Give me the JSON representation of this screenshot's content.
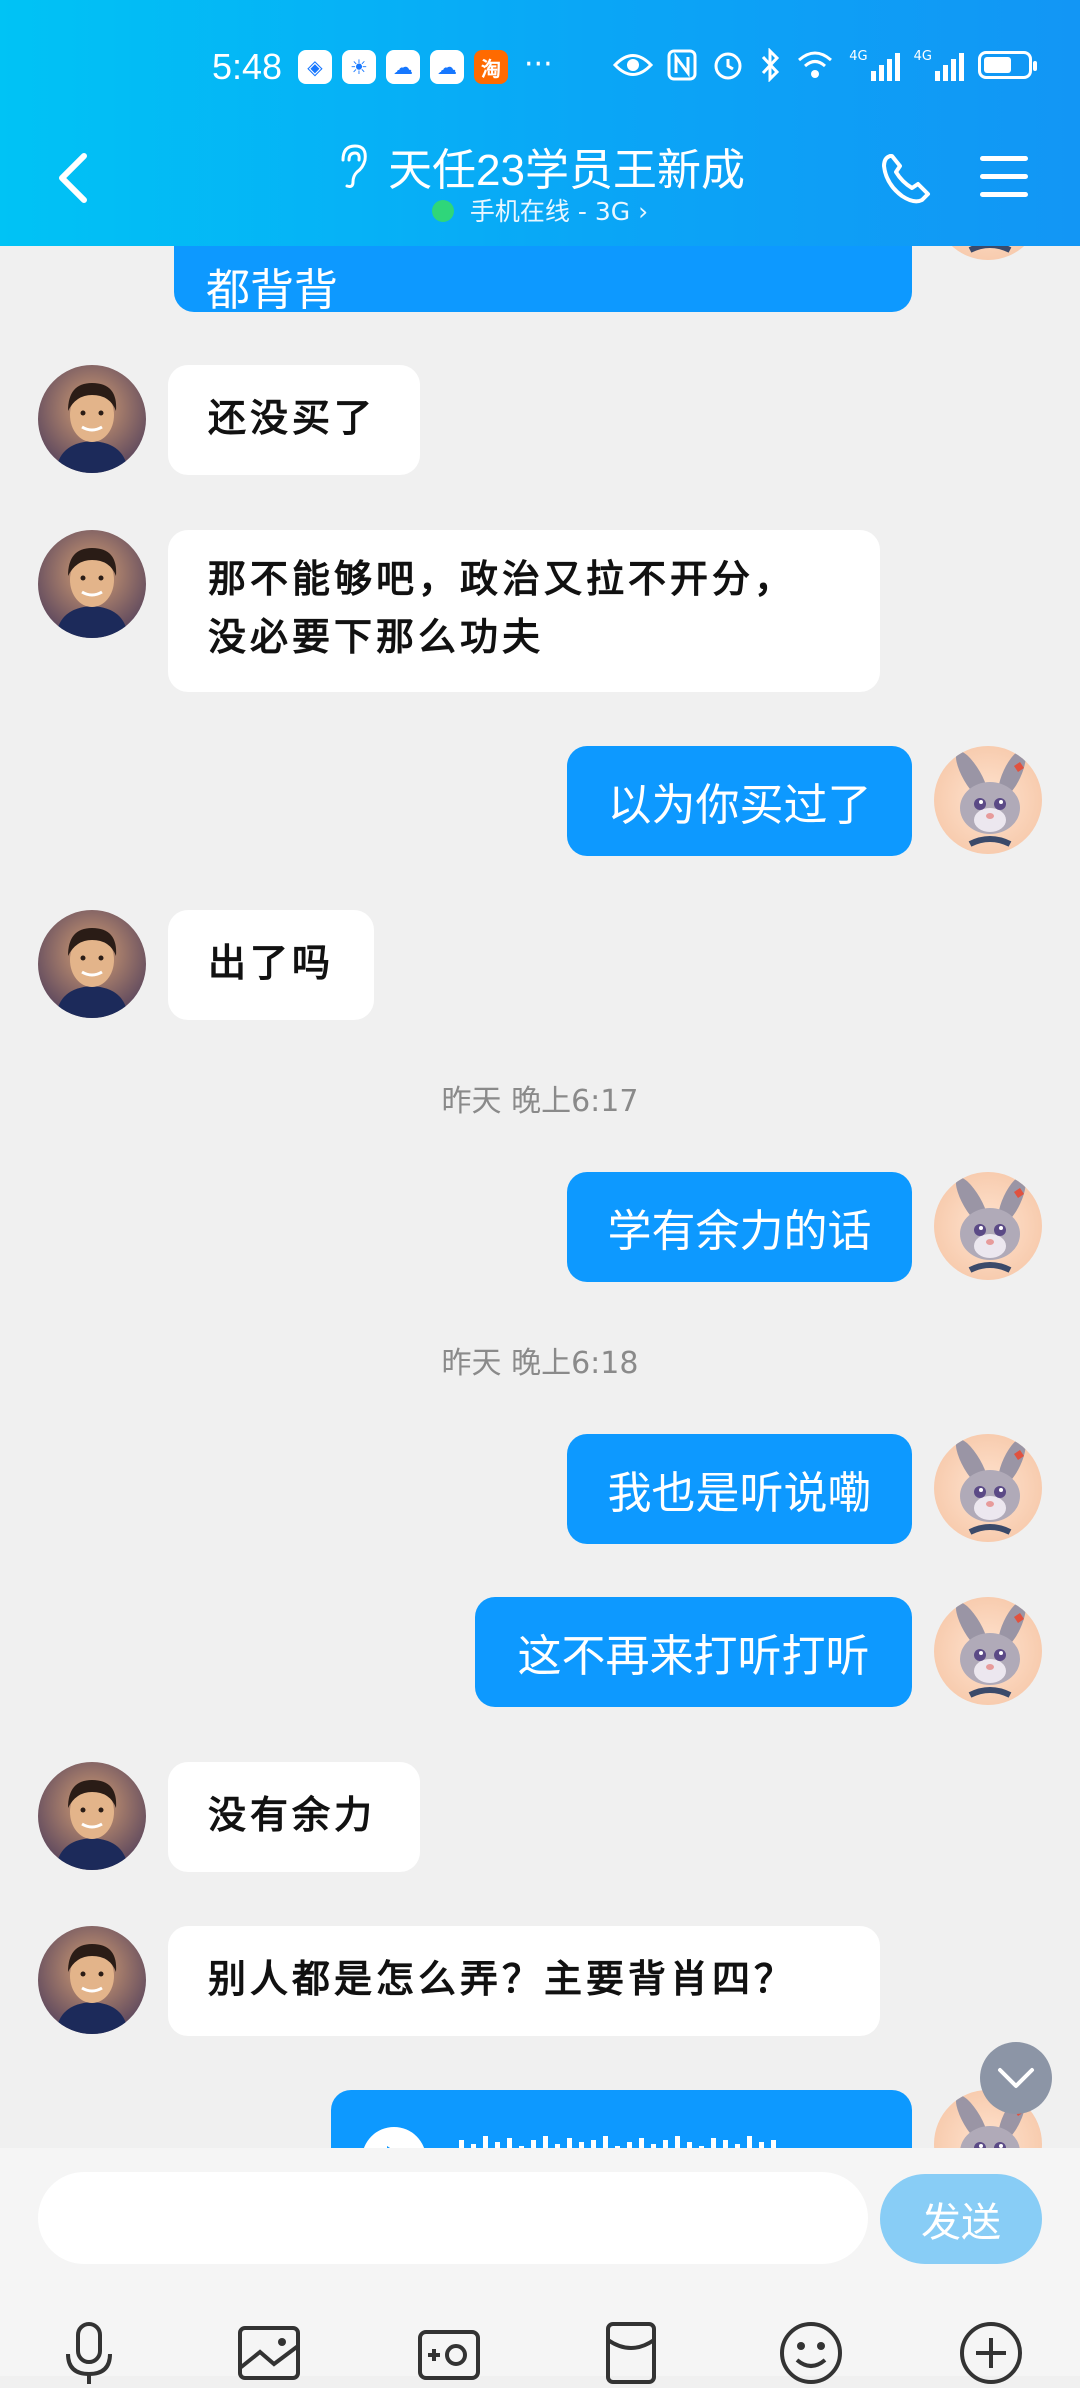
{
  "status_bar": {
    "time": "5:48",
    "notification_icons": [
      "browser-icon",
      "weather-icon",
      "cloud-icon",
      "cloud-icon",
      "taobao-icon"
    ],
    "taobao_label": "淘",
    "more": "···",
    "system_icons": [
      "eye-icon",
      "nfc-icon",
      "alarm-icon",
      "bluetooth-icon",
      "wifi-icon",
      "signal-4g-icon",
      "signal-4g-icon",
      "battery-icon"
    ],
    "net_label": "4G",
    "battery_level": 0.65
  },
  "header": {
    "title": "天任23学员王新成",
    "status_text": "手机在线 - 3G",
    "status_chevron": "›"
  },
  "messages": [
    {
      "side": "out",
      "text": "都背背"
    },
    {
      "side": "in",
      "text": "还没买了"
    },
    {
      "side": "in",
      "lines": [
        "那不能够吧，政治又拉不开分，",
        "没必要下那么功夫"
      ]
    },
    {
      "side": "out",
      "text": "以为你买过了"
    },
    {
      "side": "in",
      "text": "出了吗"
    },
    {
      "side": "time",
      "text": "昨天 晚上6:17"
    },
    {
      "side": "out",
      "text": "学有余力的话"
    },
    {
      "side": "time",
      "text": "昨天 晚上6:18"
    },
    {
      "side": "out",
      "text": "我也是听说嘞"
    },
    {
      "side": "out",
      "text": "这不再来打听打听"
    },
    {
      "side": "in",
      "text": "没有余力"
    },
    {
      "side": "in",
      "text": "别人都是怎么弄？主要背肖四？"
    },
    {
      "side": "out",
      "type": "voice"
    }
  ],
  "input": {
    "placeholder": "",
    "send_label": "发送"
  },
  "toolbar": [
    "mic-icon",
    "image-icon",
    "camera-icon",
    "red-packet-icon",
    "emoji-icon",
    "plus-icon"
  ],
  "colors": {
    "header_start": "#00c3f5",
    "header_end": "#1296f5",
    "outgoing_bubble": "#0d99ff",
    "incoming_bubble": "#ffffff",
    "online_dot": "#2fd67a",
    "send_button": "#88cdf6"
  }
}
